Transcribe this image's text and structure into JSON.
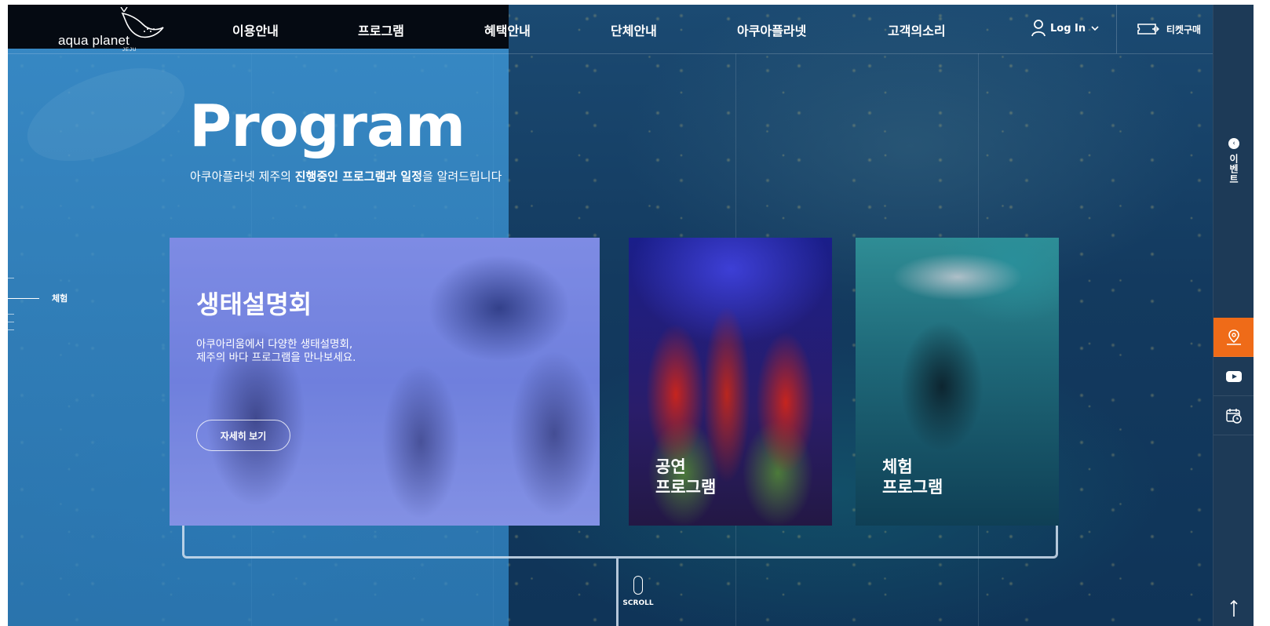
{
  "brand": {
    "name": "aqua planet",
    "sub": "JEJU"
  },
  "nav": {
    "items": [
      {
        "label": "이용안내"
      },
      {
        "label": "프로그램"
      },
      {
        "label": "혜택안내"
      },
      {
        "label": "단체안내"
      },
      {
        "label": "아쿠아플라넷"
      },
      {
        "label": "고객의소리"
      }
    ],
    "login_label": "Log In",
    "ticket_label": "티켓구매"
  },
  "hero": {
    "title": "Program",
    "subtitle_pre": "아쿠아플라넷 제주의 ",
    "subtitle_bold1": "진행중인 프로그램과 일정",
    "subtitle_post": "을 알려드립니다"
  },
  "pager": {
    "active_label": "체험"
  },
  "cards": {
    "main": {
      "title": "생태설명회",
      "desc": "아쿠아리움에서 다양한 생태설명회,\n제주의 바다 프로그램을 만나보세요.",
      "button": "자세히 보기"
    },
    "show": {
      "label": "공연\n프로그램"
    },
    "experience": {
      "label": "체험\n프로그램"
    }
  },
  "scroll": {
    "label": "SCROLL"
  },
  "rail": {
    "event_label": "이벤트"
  },
  "colors": {
    "accent_orange": "#ef6b18",
    "panel_blue": "#3d93d6",
    "rail": "#1d3a57"
  }
}
